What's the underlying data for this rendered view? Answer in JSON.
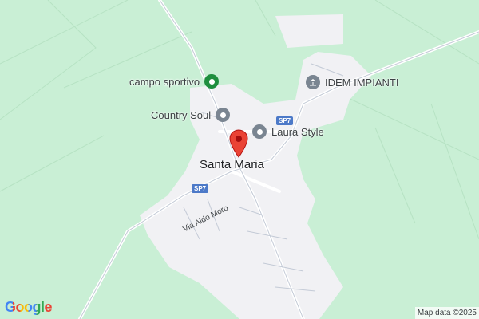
{
  "map": {
    "place_name": "Santa Maria",
    "pois": [
      {
        "name": "campo sportivo",
        "icon": "pin-icon",
        "color": "#1e8e3e"
      },
      {
        "name": "Country Soul",
        "icon": "shopping-icon",
        "color": "#7a8591"
      },
      {
        "name": "Laura Style",
        "icon": "shopping-icon",
        "color": "#7a8591"
      },
      {
        "name": "IDEM IMPIANTI",
        "icon": "museum-icon",
        "color": "#7a8591"
      }
    ],
    "roads": {
      "sp7_shield_1": "SP7",
      "sp7_shield_2": "SP7",
      "street_name": "Via Aldo Moro"
    },
    "marker": {
      "icon": "location-marker-icon",
      "color": "#ea4335"
    },
    "colors": {
      "background": "#c9efd5",
      "urban": "#f1f1f4",
      "road": "#ffffff",
      "shield": "#4c79c8"
    }
  },
  "footer": {
    "logo_text": "Google",
    "attribution": "Map data ©2025"
  }
}
